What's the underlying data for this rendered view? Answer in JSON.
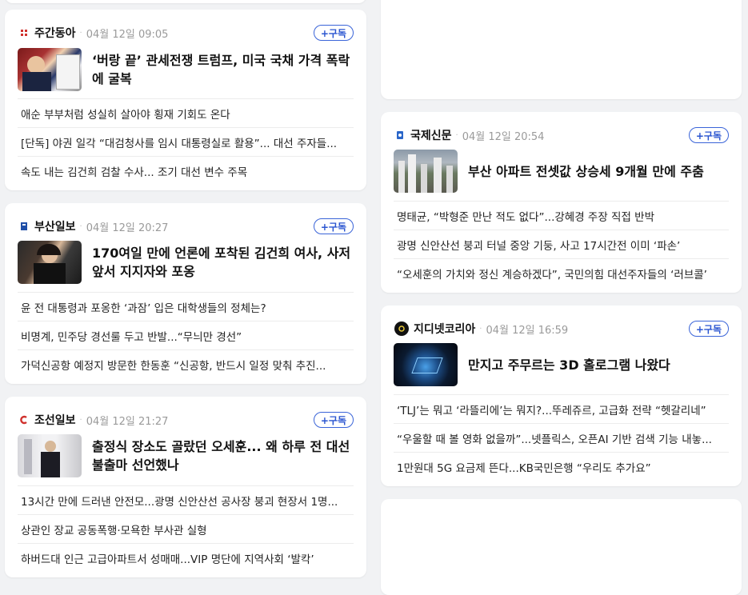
{
  "cards": [
    {
      "press": "주간동아",
      "date": "04월 12일 09:05",
      "subscribe": "+구독",
      "headline": "‘버랑 끝’ 관세전쟁 트럼프, 미국 국채 가격 폭락에 굴복",
      "items": [
        "애순 부부처럼 성실히 살아야 횡재 기회도 온다",
        "[단독] 야권 일각 “대검청사를 임시 대통령실로 활용”... 대선 주자들...",
        "속도 내는 김건희 검찰 수사... 조기 대선 변수 주목"
      ],
      "logo_color": "#d0312d",
      "logo_icon": "weekly-donga-logo"
    },
    {
      "press": "부산일보",
      "date": "04월 12일 20:27",
      "subscribe": "+구독",
      "headline": "170여일 만에 언론에 포착된 김건희 여사, 사저 앞서 지지자와 포옹",
      "items": [
        "윤 전 대통령과 포옹한 ‘과잠’ 입은 대학생들의 정체는?",
        "비명계, 민주당 경선룰 두고 반발...“무늬만 경선”",
        "가덕신공항 예정지 방문한 한동훈 “신공항, 반드시 일정 맞춰 추진..."
      ],
      "logo_color": "#1f4fa8",
      "logo_icon": "busan-ilbo-logo"
    },
    {
      "press": "조선일보",
      "date": "04월 12일 21:27",
      "subscribe": "+구독",
      "headline": "출정식 장소도 골랐던 오세훈... 왜 하루 전 대선 불출마 선언했나",
      "items": [
        "13시간 만에 드러낸 안전모...광명 신안산선 공사장 붕괴 현장서 1명...",
        "상관인 장교 공동폭행·모욕한 부사관 실형",
        "하버드대 인근 고급아파트서 성매매...VIP 명단에 지역사회 ‘발칵’"
      ],
      "logo_color": "#d0312d",
      "logo_icon": "chosun-ilbo-logo"
    },
    {
      "press": "국제신문",
      "date": "04월 12일 20:54",
      "subscribe": "+구독",
      "headline": "부산 아파트 전셋값 상승세 9개월 만에 주춤",
      "items": [
        "명태균, “박형준 만난 적도 없다”...강혜경 주장 직접 반박",
        "광명 신안산선 붕괴 터널 중앙 기둥, 사고 17시간전 이미 ‘파손’",
        "“오세훈의 가치와 정신 계승하겠다”, 국민의힘 대선주자들의 ‘러브콜’"
      ],
      "logo_color": "#2a66c9",
      "logo_icon": "kookje-logo"
    },
    {
      "press": "지디넷코리아",
      "date": "04월 12일 16:59",
      "subscribe": "+구독",
      "headline": "만지고 주무르는 3D 홀로그램 나왔다",
      "items": [
        "‘TLJ’는 뭐고 ‘라뜰리에’는 뭐지?...뚜레쥬르, 고급화 전략 “헷갈리네”",
        "“우울할 때 볼 영화 없을까”...넷플릭스, 오픈AI 기반 검색 기능 내놓...",
        "1만원대 5G 요금제 뜬다...KB국민은행 “우리도 추가요”"
      ],
      "logo_color": "#111111",
      "logo_icon": "zdnet-logo"
    }
  ]
}
